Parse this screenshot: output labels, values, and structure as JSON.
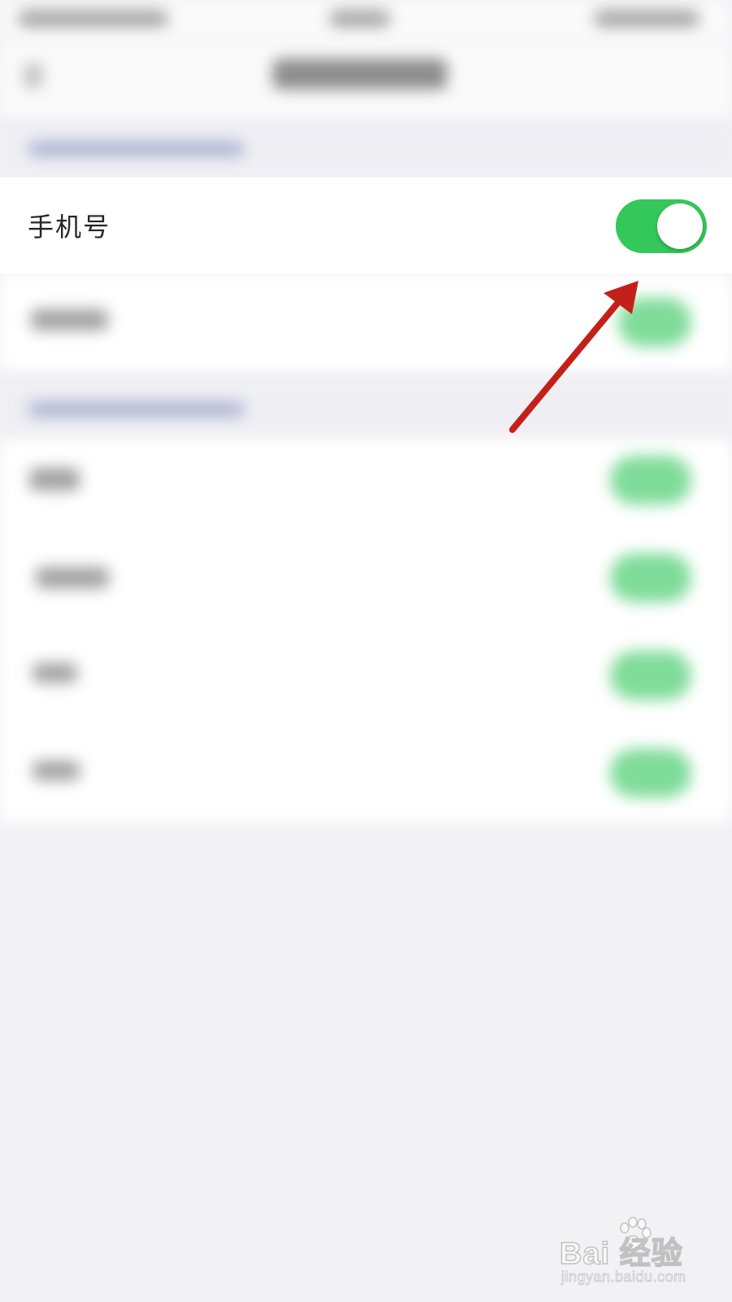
{
  "row": {
    "label": "手机号",
    "toggle_on": true
  },
  "colors": {
    "toggle_on": "#34c759",
    "annotation_arrow": "#c4201a",
    "background": "#f2f2f5"
  },
  "watermark": {
    "main": "Bai   经验",
    "sub": "jingyan.baidu.com"
  },
  "icons": {
    "watermark_logo": "baidu-paw-icon",
    "annotation": "red-arrow-icon"
  }
}
